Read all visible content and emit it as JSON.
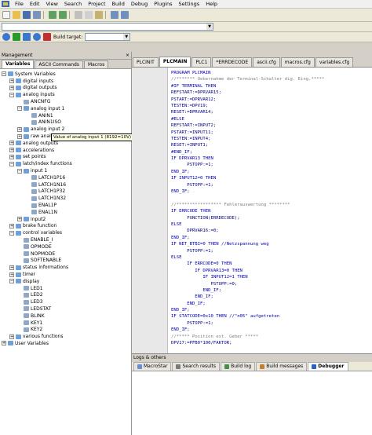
{
  "menu": [
    "File",
    "Edit",
    "View",
    "Search",
    "Project",
    "Build",
    "Debug",
    "Plugins",
    "Settings",
    "Help"
  ],
  "toolbar": {
    "build_target_label": "Build target:",
    "build_target_value": ""
  },
  "management": {
    "title": "Management",
    "close": "×",
    "tabs": [
      "Variables",
      "ASCII Commands",
      "Macros"
    ],
    "tooltip": "Value of analog input 1 (8192=10V)"
  },
  "tree": [
    {
      "label": "System Variables",
      "level": 0,
      "exp": "−",
      "icon": "folder"
    },
    {
      "label": "digital inputs",
      "level": 1,
      "exp": "+",
      "icon": "folder"
    },
    {
      "label": "digital outputs",
      "level": 1,
      "exp": "+",
      "icon": "folder"
    },
    {
      "label": "analog inputs",
      "level": 1,
      "exp": "−",
      "icon": "folder"
    },
    {
      "label": "ANCNFG",
      "level": 2,
      "exp": "",
      "icon": "var"
    },
    {
      "label": "analog input 1",
      "level": 2,
      "exp": "−",
      "icon": "folder"
    },
    {
      "label": "ANIN1",
      "level": 3,
      "exp": "",
      "icon": "var"
    },
    {
      "label": "ANIN1ISO",
      "level": 3,
      "exp": "",
      "icon": "var"
    },
    {
      "label": "analog input 2",
      "level": 2,
      "exp": "+",
      "icon": "folder"
    },
    {
      "label": "raw analog channels",
      "level": 2,
      "exp": "+",
      "icon": "folder"
    },
    {
      "label": "analog outputs",
      "level": 1,
      "exp": "+",
      "icon": "folder"
    },
    {
      "label": "accelerations",
      "level": 1,
      "exp": "+",
      "icon": "folder"
    },
    {
      "label": "set points",
      "level": 1,
      "exp": "+",
      "icon": "folder"
    },
    {
      "label": "latch/index functions",
      "level": 1,
      "exp": "−",
      "icon": "folder"
    },
    {
      "label": "input 1",
      "level": 2,
      "exp": "−",
      "icon": "folder"
    },
    {
      "label": "LATCH1P16",
      "level": 3,
      "exp": "",
      "icon": "var"
    },
    {
      "label": "LATCH1N16",
      "level": 3,
      "exp": "",
      "icon": "var"
    },
    {
      "label": "LATCH1P32",
      "level": 3,
      "exp": "",
      "icon": "var"
    },
    {
      "label": "LATCH1N32",
      "level": 3,
      "exp": "",
      "icon": "var"
    },
    {
      "label": "ENAL1P",
      "level": 3,
      "exp": "",
      "icon": "var"
    },
    {
      "label": "ENAL1N",
      "level": 3,
      "exp": "",
      "icon": "var"
    },
    {
      "label": "input2",
      "level": 2,
      "exp": "+",
      "icon": "folder"
    },
    {
      "label": "brake function",
      "level": 1,
      "exp": "+",
      "icon": "folder"
    },
    {
      "label": "control variables",
      "level": 1,
      "exp": "−",
      "icon": "folder"
    },
    {
      "label": "ENABLE_I",
      "level": 2,
      "exp": "",
      "icon": "var"
    },
    {
      "label": "OPMODE",
      "level": 2,
      "exp": "",
      "icon": "var"
    },
    {
      "label": "NOPMODE",
      "level": 2,
      "exp": "",
      "icon": "var"
    },
    {
      "label": "SOFTENABLE",
      "level": 2,
      "exp": "",
      "icon": "var"
    },
    {
      "label": "status informations",
      "level": 1,
      "exp": "+",
      "icon": "folder"
    },
    {
      "label": "timer",
      "level": 1,
      "exp": "+",
      "icon": "folder"
    },
    {
      "label": "display",
      "level": 1,
      "exp": "−",
      "icon": "folder"
    },
    {
      "label": "LED1",
      "level": 2,
      "exp": "",
      "icon": "var"
    },
    {
      "label": "LED2",
      "level": 2,
      "exp": "",
      "icon": "var"
    },
    {
      "label": "LED3",
      "level": 2,
      "exp": "",
      "icon": "var"
    },
    {
      "label": "LEDSTAT",
      "level": 2,
      "exp": "",
      "icon": "var"
    },
    {
      "label": "BLINK",
      "level": 2,
      "exp": "",
      "icon": "var"
    },
    {
      "label": "KEY1",
      "level": 2,
      "exp": "",
      "icon": "var"
    },
    {
      "label": "KEY2",
      "level": 2,
      "exp": "",
      "icon": "var"
    },
    {
      "label": "various functions",
      "level": 1,
      "exp": "+",
      "icon": "folder"
    },
    {
      "label": "User Variables",
      "level": 0,
      "exp": "+",
      "icon": "folder"
    }
  ],
  "editor_tabs": [
    {
      "label": "PLCINIT",
      "active": false
    },
    {
      "label": "PLCMAIN",
      "active": true
    },
    {
      "label": "PLC1",
      "active": false
    },
    {
      "label": "*ERRDECODE",
      "active": false
    },
    {
      "label": "ascii.cfg",
      "active": false
    },
    {
      "label": "macros.cfg",
      "active": false
    },
    {
      "label": "variables.cfg",
      "active": false
    }
  ],
  "code": [
    {
      "t": "PROGRAM PLCMAIN",
      "c": "kw"
    },
    {
      "t": "//******* Uebernahme der Terminal-Schalter dig. Eing.*****",
      "c": "cm"
    },
    {
      "t": "#IF TERMINAL THEN",
      "c": "kw"
    },
    {
      "t": "REFSTART:=DPRVAR15;",
      "c": ""
    },
    {
      "t": "PSTART:=DPRVAR12;",
      "c": ""
    },
    {
      "t": "TESTEN:=DPV19;",
      "c": ""
    },
    {
      "t": "RESET:=DPRVAR14;",
      "c": ""
    },
    {
      "t": "#ELSE",
      "c": "kw"
    },
    {
      "t": "REFSTART:=INPUT2;",
      "c": ""
    },
    {
      "t": "PSTART:=INPUT11;",
      "c": ""
    },
    {
      "t": "TESTEN:=INPUT4;",
      "c": ""
    },
    {
      "t": "RESET:=INPUT1;",
      "c": ""
    },
    {
      "t": "#END_IF;",
      "c": "kw"
    },
    {
      "t": "IF DPRVAR13 THEN",
      "c": "kw"
    },
    {
      "t": "      PSTOPP:=1;",
      "c": ""
    },
    {
      "t": "END_IF;",
      "c": "kw"
    },
    {
      "t": "IF INPUT12=0 THEN",
      "c": "kw"
    },
    {
      "t": "      PSTOPP:=1;",
      "c": ""
    },
    {
      "t": "END_IF;",
      "c": "kw"
    },
    {
      "t": "",
      "c": ""
    },
    {
      "t": "//***************** Fehlerauswertung ********",
      "c": "cm"
    },
    {
      "t": "IF ERRCODE THEN",
      "c": "kw"
    },
    {
      "t": "      FUNCTION(ERRDECODE);",
      "c": ""
    },
    {
      "t": "ELSE",
      "c": "kw"
    },
    {
      "t": "      DPRVAR16:=0;",
      "c": ""
    },
    {
      "t": "END_IF;",
      "c": "kw"
    },
    {
      "t": "IF NET_BTBI=0 THEN //Netzspannung weg",
      "c": "kw"
    },
    {
      "t": "      PSTOPP:=1;",
      "c": ""
    },
    {
      "t": "ELSE",
      "c": "kw"
    },
    {
      "t": "      IF ERRCODE=0 THEN",
      "c": "kw"
    },
    {
      "t": "         IF DPRVAR13=0 THEN",
      "c": "kw"
    },
    {
      "t": "            IF INPUT12=1 THEN",
      "c": "kw"
    },
    {
      "t": "               PSTOPP:=0;",
      "c": ""
    },
    {
      "t": "            END_IF;",
      "c": "kw"
    },
    {
      "t": "         END_IF;",
      "c": "kw"
    },
    {
      "t": "      END_IF;",
      "c": "kw"
    },
    {
      "t": "END_IF;",
      "c": "kw"
    },
    {
      "t": "IF STATCODE=0x10 THEN //\"n05\" aufgetreten",
      "c": "kw"
    },
    {
      "t": "      PSTOPP:=1;",
      "c": ""
    },
    {
      "t": "END_IF;",
      "c": "kw"
    },
    {
      "t": "//***** Position ext. Geber *****",
      "c": "cm"
    },
    {
      "t": "DPV17:=PFB0*100/FAKTOR;",
      "c": ""
    }
  ],
  "logs": {
    "title": "Logs & others",
    "tabs": [
      {
        "label": "MacroStar",
        "active": false,
        "color": "#6a8fd0"
      },
      {
        "label": "Search results",
        "active": false,
        "color": "#7a7a7a"
      },
      {
        "label": "Build log",
        "active": false,
        "color": "#4a8a4a"
      },
      {
        "label": "Build messages",
        "active": false,
        "color": "#c08030"
      },
      {
        "label": "Debugger",
        "active": true,
        "color": "#3060c0"
      }
    ]
  }
}
